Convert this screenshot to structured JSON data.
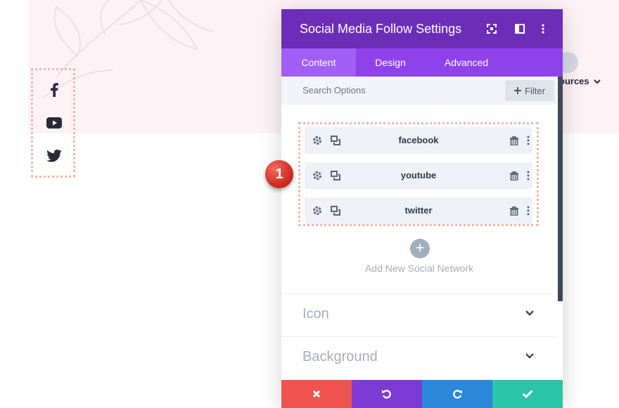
{
  "modal": {
    "title": "Social Media Follow Settings",
    "tabs": [
      {
        "label": "Content",
        "active": true
      },
      {
        "label": "Design",
        "active": false
      },
      {
        "label": "Advanced",
        "active": false
      }
    ],
    "search_placeholder": "Search Options",
    "filter_label": "Filter",
    "networks": [
      {
        "label": "facebook"
      },
      {
        "label": "youtube"
      },
      {
        "label": "twitter"
      }
    ],
    "add_label": "Add New Social Network",
    "sections": [
      {
        "label": "Icon"
      },
      {
        "label": "Background"
      }
    ],
    "footer": {
      "cancel_color": "#ef5350",
      "undo_color": "#7d3bd6",
      "redo_color": "#2b87da",
      "save_color": "#29c4a9"
    }
  },
  "page": {
    "nav_resources": "ources",
    "social_icons": [
      "facebook-icon",
      "youtube-icon",
      "twitter-icon"
    ]
  },
  "annotation": {
    "marker": "1"
  },
  "colors": {
    "header": "#6c2eb9",
    "tabs": "#8f42ec",
    "active_tab": "#a15ff6"
  }
}
